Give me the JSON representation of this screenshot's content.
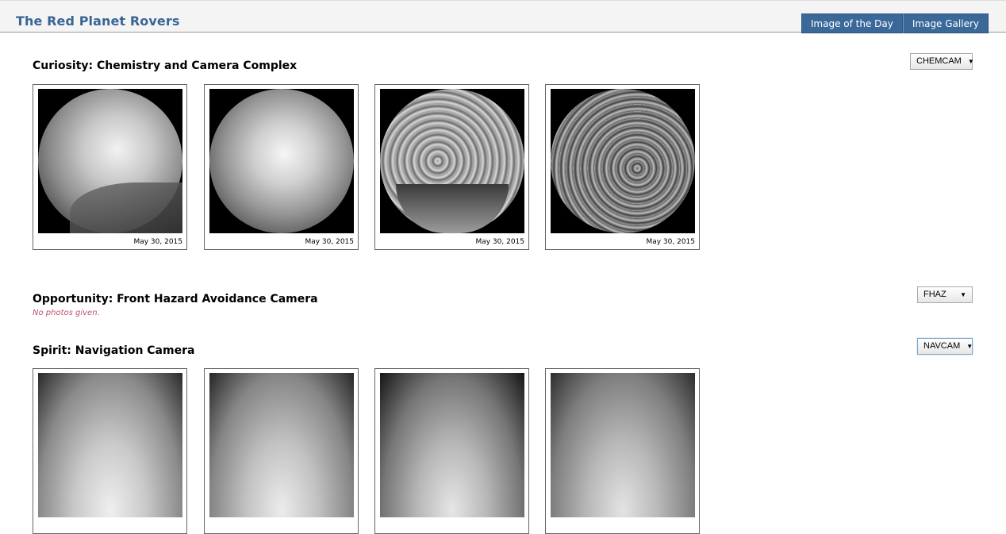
{
  "header": {
    "title": "The Red Planet Rovers",
    "nav": [
      "Image of the Day",
      "Image Gallery"
    ]
  },
  "sections": [
    {
      "title": "Curiosity: Chemistry and Camera Complex",
      "camera": "CHEMCAM",
      "photos": [
        {
          "date": "May 30, 2015",
          "style": "chemcam-1"
        },
        {
          "date": "May 30, 2015",
          "style": "chemcam-2"
        },
        {
          "date": "May 30, 2015",
          "style": "chemcam-3"
        },
        {
          "date": "May 30, 2015",
          "style": "chemcam-4"
        }
      ]
    },
    {
      "title": "Opportunity: Front Hazard Avoidance Camera",
      "camera": "FHAZ",
      "empty_message": "No photos given."
    },
    {
      "title": "Spirit: Navigation Camera",
      "camera": "NAVCAM",
      "photos": [
        {
          "style": "navcam-1"
        },
        {
          "style": "navcam-2"
        },
        {
          "style": "navcam-3"
        },
        {
          "style": "navcam-4"
        }
      ]
    }
  ],
  "colors": {
    "brand": "#3a6593",
    "nav_button": "#3a6899",
    "empty_message": "#c0506a"
  }
}
